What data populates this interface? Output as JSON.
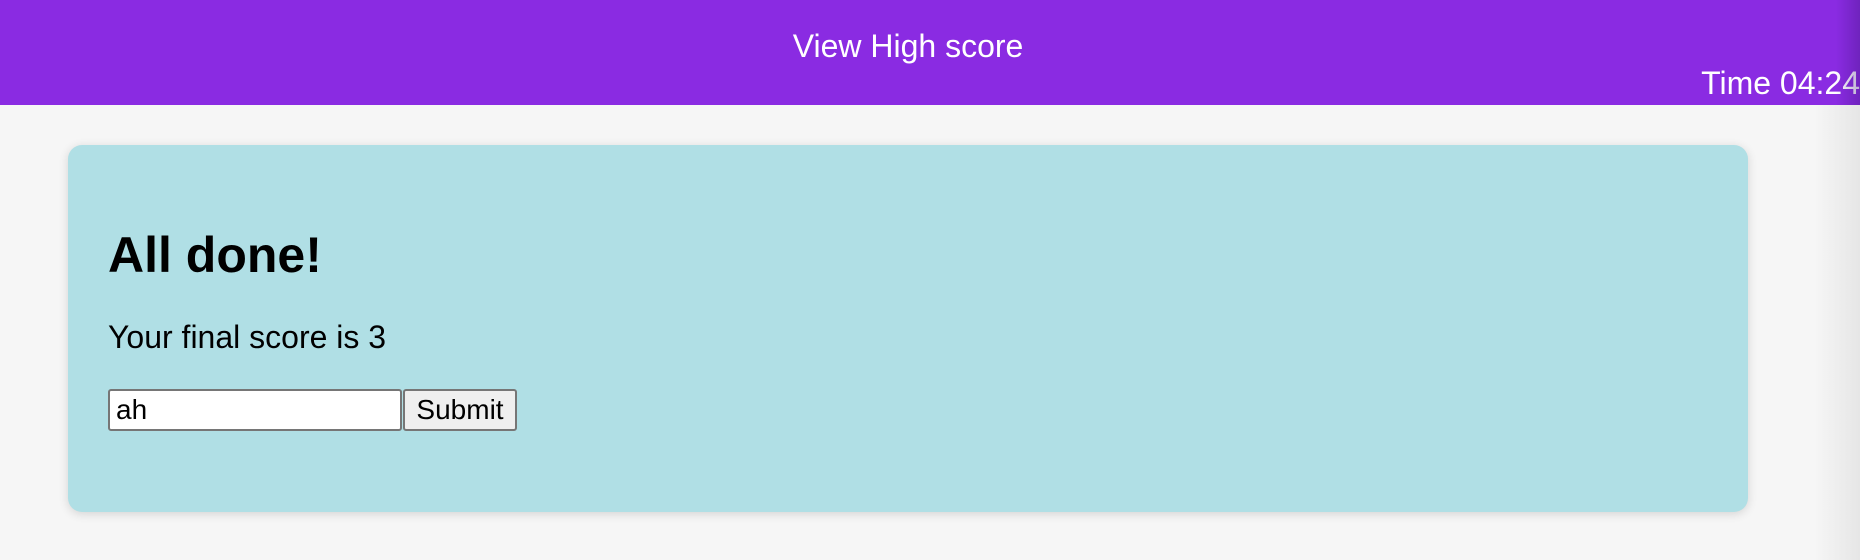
{
  "header": {
    "view_high_score_label": "View High score",
    "timer_text": "Time 04:24"
  },
  "result": {
    "title": "All done!",
    "score_text": "Your final score is 3"
  },
  "form": {
    "initials_value": "ah",
    "submit_label": "Submit"
  },
  "colors": {
    "header_background": "#8a2be2",
    "card_background": "#b0dfe5",
    "page_background": "#f6f6f6"
  }
}
